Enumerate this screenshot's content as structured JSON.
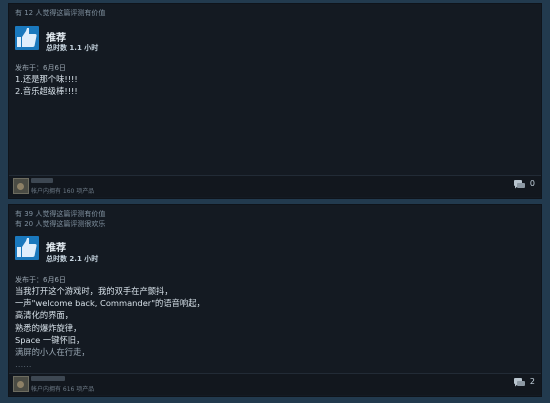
{
  "reviews": [
    {
      "helpful": [
        "有 12 人觉得这篇评测有价值"
      ],
      "verdict": "推荐",
      "hours": "总时数 1.1 小时",
      "posted": "发布于：6月6日",
      "body": [
        "1.还是那个味!!!!",
        "2.音乐超级棒!!!!"
      ],
      "products": "帐户内拥有 160 项产品",
      "comments": "0"
    },
    {
      "helpful": [
        "有 39 人觉得这篇评测有价值",
        "有 20 人觉得这篇评测很欢乐"
      ],
      "verdict": "推荐",
      "hours": "总时数 2.1 小时",
      "posted": "发布于：6月6日",
      "body": [
        "当我打开这个游戏时，我的双手在产颤抖，",
        "一声\"welcome back, Commander\"的语音响起，",
        "高清化的界面，",
        "熟悉的爆炸旋律，",
        "Space 一键怀旧，",
        "满屏的小人在行走，",
        "……"
      ],
      "products": "帐户内拥有 616 项产品",
      "comments": "2"
    }
  ],
  "icons": {
    "thumb": "thumbs-up-icon",
    "comment": "comment-icon"
  },
  "colors": {
    "background": "#223a4e",
    "card": "#141a22",
    "thumb_box": "#1a78bd"
  }
}
